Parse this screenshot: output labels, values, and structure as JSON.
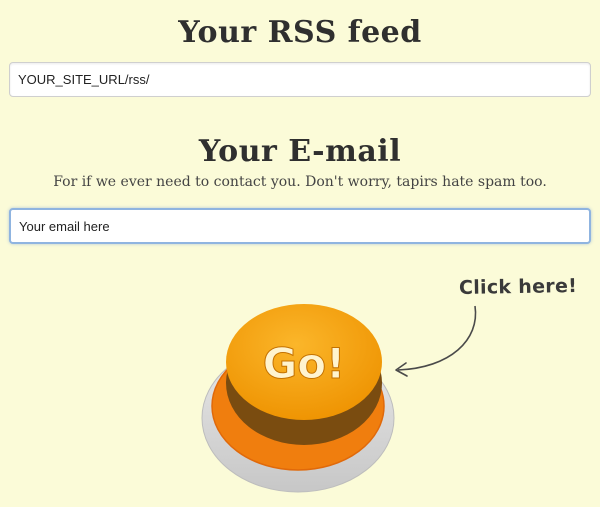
{
  "rss": {
    "title": "Your RSS feed",
    "value": "YOUR_SITE_URL/rss/"
  },
  "email": {
    "title": "Your E-mail",
    "subtitle": "For if we ever need to contact you. Don't worry, tapirs hate spam too.",
    "placeholder": "Your email here"
  },
  "cta": {
    "hint": "Click here!",
    "button_label": "Go!"
  },
  "colors": {
    "background": "#fbfbd8",
    "button_top": "#f5a10a",
    "button_rim": "#f07e0e",
    "button_side": "#7a4c10",
    "focus_border": "#8fb4e0"
  }
}
